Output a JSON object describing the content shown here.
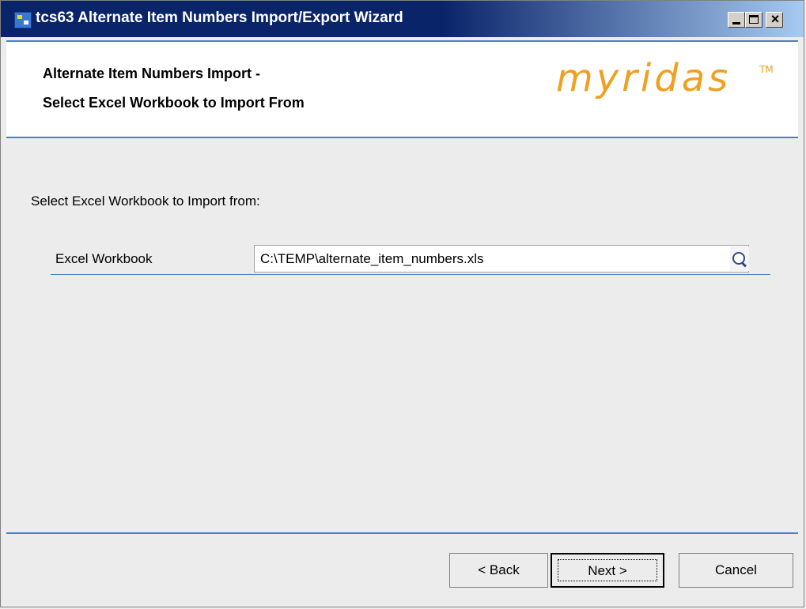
{
  "window": {
    "title": "tcs63 Alternate Item Numbers Import/Export Wizard",
    "close_glyph": "×"
  },
  "header": {
    "line1": "Alternate Item Numbers Import -",
    "line2": "Select Excel Workbook to Import From",
    "logo": "myridas",
    "logo_tm": "TM"
  },
  "body": {
    "instruction": "Select Excel Workbook to Import from:",
    "field_label": "Excel Workbook",
    "field_value": "C:\\TEMP\\alternate_item_numbers.xls"
  },
  "buttons": {
    "back": "< Back",
    "next": "Next >",
    "cancel": "Cancel"
  },
  "colors": {
    "title_bar": "#0a246a",
    "accent_line": "#4a7fc8",
    "logo": "#f0a020"
  },
  "icons": [
    "app-icon",
    "minimize-icon",
    "maximize-icon",
    "close-icon",
    "search-icon"
  ]
}
